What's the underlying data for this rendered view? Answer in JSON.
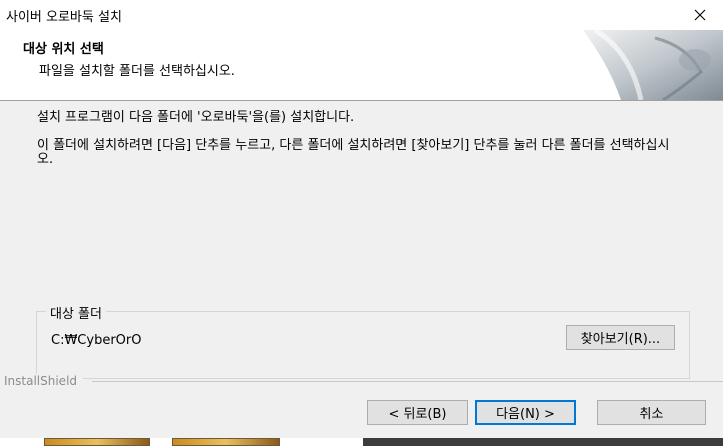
{
  "window": {
    "title": "사이버 오로바둑 설치"
  },
  "header": {
    "title": "대상 위치 선택",
    "subtitle": "파일을 설치할 폴더를 선택하십시오."
  },
  "body": {
    "line1": "설치 프로그램이 다음 폴더에 '오로바둑'을(를) 설치합니다.",
    "line2": "이 폴더에 설치하려면 [다음] 단추를 누르고, 다른 폴더에 설치하려면 [찾아보기] 단추를 눌러 다른 폴더를 선택하십시오."
  },
  "destination": {
    "label": "대상 폴더",
    "path": "C:₩CyberOrO",
    "browse_label": "찾아보기(R)..."
  },
  "footer": {
    "brand": "InstallShield",
    "back_label": "< 뒤로(B)",
    "next_label": "다음(N) >",
    "cancel_label": "취소"
  },
  "icons": {
    "close": "close-icon",
    "header_art": "installer-art-icon"
  }
}
